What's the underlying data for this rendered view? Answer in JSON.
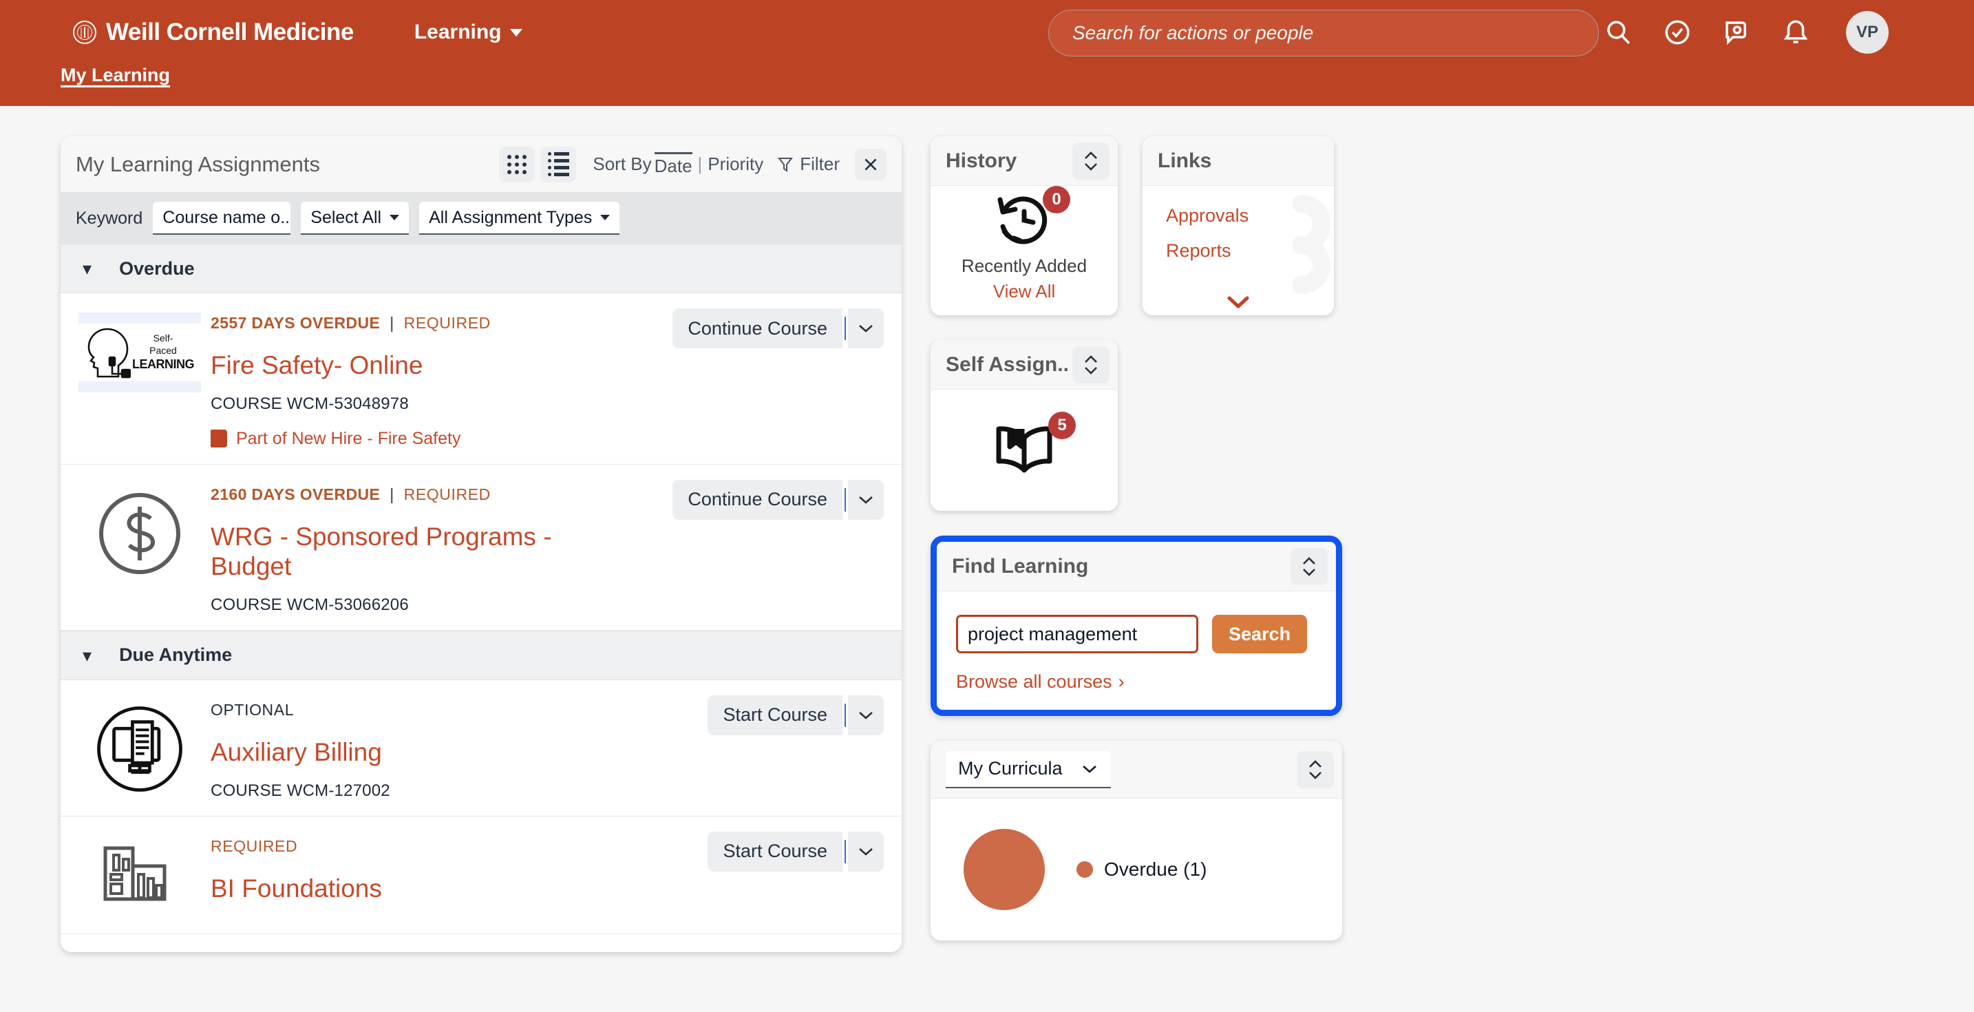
{
  "header": {
    "brand": "Weill Cornell Medicine",
    "app_menu": "Learning",
    "search_placeholder": "Search for actions or people",
    "avatar_initials": "VP",
    "icons": [
      "search-icon",
      "tasks-icon",
      "inbox-icon",
      "notifications-icon"
    ],
    "subnav_label": "My Learning",
    "accent_color": "#bc4425"
  },
  "assignments": {
    "title": "My Learning Assignments",
    "sort_prefix": "Sort By",
    "sort_active": "Date",
    "sort_separator": "|",
    "sort_other": "Priority",
    "filter_label": "Filter",
    "close_label": "✕",
    "keyword_label": "Keyword",
    "keyword_value": "Course name o...",
    "select_all_label": "Select All",
    "assignment_types_label": "All Assignment Types",
    "sections": [
      {
        "name": "Overdue",
        "rows": [
          {
            "meta_overdue": "2557 DAYS OVERDUE",
            "meta_sep": "|",
            "meta_tag": "REQUIRED",
            "title": "Fire Safety- Online",
            "code": "COURSE WCM-53048978",
            "part_of": "Part of New Hire - Fire Safety",
            "action": "Continue Course",
            "thumb": "self-paced-learning-thumbnail"
          },
          {
            "meta_overdue": "2160 DAYS OVERDUE",
            "meta_sep": "|",
            "meta_tag": "REQUIRED",
            "title": "WRG - Sponsored Programs - Budget",
            "code": "COURSE WCM-53066206",
            "part_of": "",
            "action": "Continue Course",
            "thumb": "dollar-sign-thumbnail"
          }
        ]
      },
      {
        "name": "Due Anytime",
        "rows": [
          {
            "meta_overdue": "",
            "meta_sep": "",
            "meta_tag": "OPTIONAL",
            "title": "Auxiliary Billing",
            "code": "COURSE WCM-127002",
            "part_of": "",
            "action": "Start Course",
            "thumb": "monitor-document-thumbnail"
          },
          {
            "meta_overdue": "",
            "meta_sep": "",
            "meta_tag": "REQUIRED",
            "title": "BI Foundations",
            "code": "",
            "part_of": "",
            "action": "Start Course",
            "thumb": "bar-chart-building-thumbnail"
          }
        ]
      }
    ]
  },
  "history": {
    "title": "History",
    "badge": "0",
    "label": "Recently Added",
    "view_all": "View All"
  },
  "links": {
    "title": "Links",
    "items": [
      "Approvals",
      "Reports"
    ]
  },
  "self_assign": {
    "title": "Self Assign..",
    "badge": "5"
  },
  "find_learning": {
    "title": "Find Learning",
    "input_value": "project management",
    "search_button": "Search",
    "browse_label": "Browse all courses",
    "browse_chevron": "›",
    "focus_color": "#1155ee",
    "button_color": "#d97b3c"
  },
  "curricula": {
    "title": "My Curricula",
    "chart_data": {
      "type": "pie",
      "title": "My Curricula",
      "categories": [
        "Overdue"
      ],
      "values": [
        1
      ],
      "labels": [
        "Overdue (1)"
      ],
      "colors": [
        "#cd6a47"
      ],
      "legend_position": "right",
      "total": 1
    }
  }
}
